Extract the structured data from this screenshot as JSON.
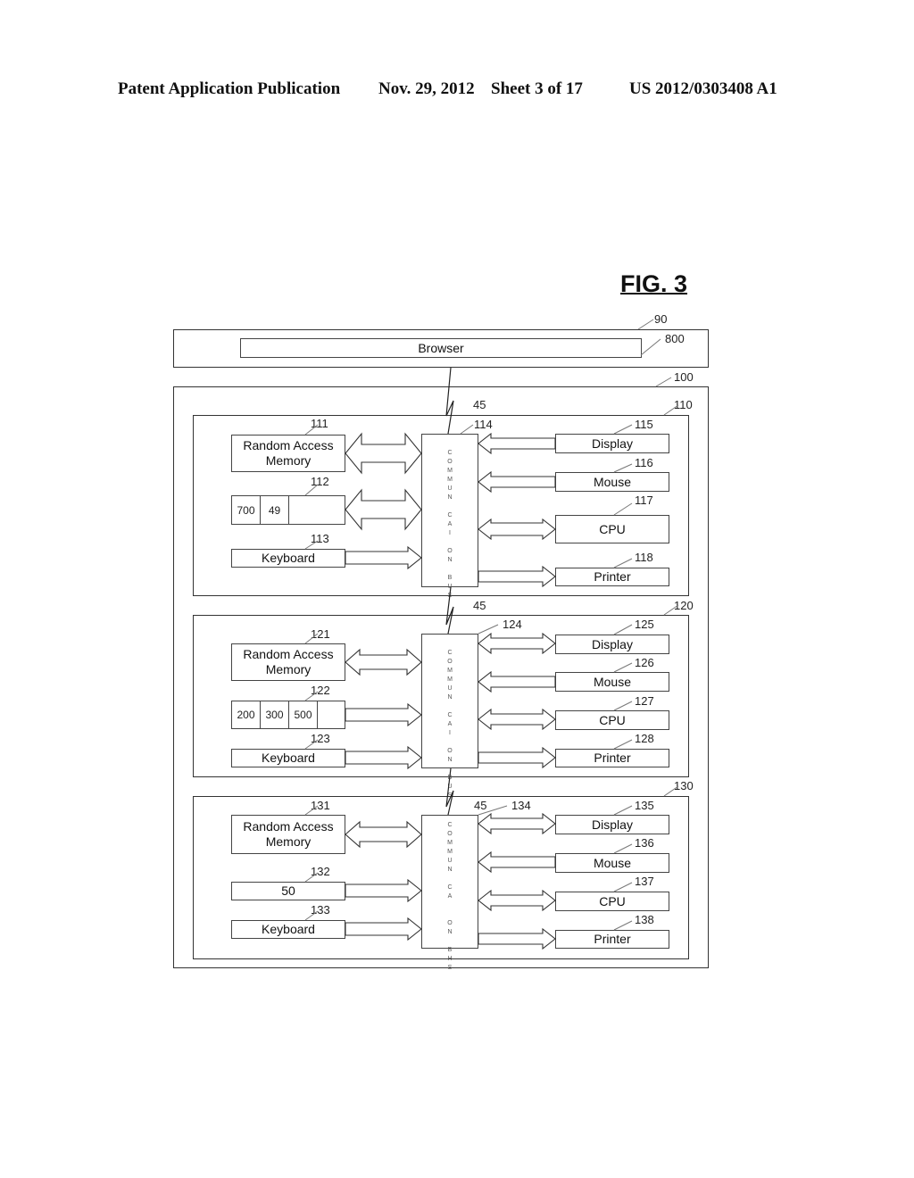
{
  "header": {
    "publication": "Patent Application Publication",
    "date": "Nov. 29, 2012",
    "sheet": "Sheet 3 of 17",
    "number": "US 2012/0303408 A1"
  },
  "figure": {
    "title": "FIG. 3",
    "client": {
      "ref": "90",
      "browser_label": "Browser",
      "browser_ref": "800"
    },
    "network_ref": "45",
    "system": {
      "ref": "100",
      "computers": [
        {
          "ref": "110",
          "ram": {
            "label_line1": "Random Access",
            "label_line2": "Memory",
            "ref": "111"
          },
          "storage": {
            "cells": [
              "700",
              "49",
              ""
            ],
            "ref": "112"
          },
          "keyboard": {
            "label": "Keyboard",
            "ref": "113"
          },
          "bus": {
            "ref": "114",
            "letters": [
              "C",
              "O",
              "M",
              "M",
              "U",
              "N",
              "",
              "C",
              "A",
              "I",
              "",
              "O",
              "N",
              "",
              "B",
              "U",
              "S"
            ]
          },
          "display": {
            "label": "Display",
            "ref": "115"
          },
          "mouse": {
            "label": "Mouse",
            "ref": "116"
          },
          "cpu": {
            "label": "CPU",
            "ref": "117"
          },
          "printer": {
            "label": "Printer",
            "ref": "118"
          },
          "network_ref": "45"
        },
        {
          "ref": "120",
          "ram": {
            "label_line1": "Random Access",
            "label_line2": "Memory",
            "ref": "121"
          },
          "storage": {
            "cells": [
              "200",
              "300",
              "500",
              ""
            ],
            "ref": "122"
          },
          "keyboard": {
            "label": "Keyboard",
            "ref": "123"
          },
          "bus": {
            "ref": "124",
            "letters": [
              "C",
              "O",
              "M",
              "M",
              "U",
              "N",
              "",
              "C",
              "A",
              "I",
              "",
              "O",
              "N",
              "",
              "B",
              "U",
              "S"
            ]
          },
          "display": {
            "label": "Display",
            "ref": "125"
          },
          "mouse": {
            "label": "Mouse",
            "ref": "126"
          },
          "cpu": {
            "label": "CPU",
            "ref": "127"
          },
          "printer": {
            "label": "Printer",
            "ref": "128"
          },
          "network_ref": "45"
        },
        {
          "ref": "130",
          "ram": {
            "label_line1": "Random Access",
            "label_line2": "Memory",
            "ref": "131"
          },
          "storage": {
            "value": "50",
            "ref": "132"
          },
          "keyboard": {
            "label": "Keyboard",
            "ref": "133"
          },
          "bus": {
            "ref": "134",
            "letters": [
              "C",
              "O",
              "M",
              "M",
              "U",
              "N",
              "",
              "C",
              "A",
              "",
              "",
              "O",
              "N",
              "",
              "B",
              "H",
              "S"
            ]
          },
          "display": {
            "label": "Display",
            "ref": "135"
          },
          "mouse": {
            "label": "Mouse",
            "ref": "136"
          },
          "cpu": {
            "label": "CPU",
            "ref": "137"
          },
          "printer": {
            "label": "Printer",
            "ref": "138"
          },
          "network_ref": "45"
        }
      ]
    }
  }
}
